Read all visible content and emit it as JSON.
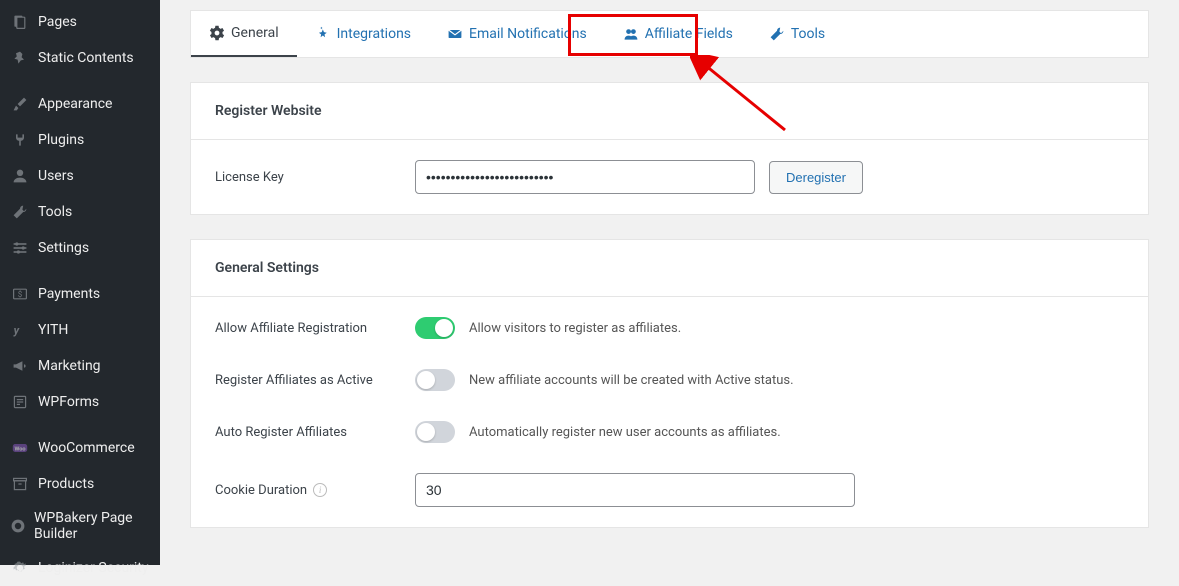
{
  "sidebar": {
    "items": [
      {
        "label": "Pages",
        "icon": "pages"
      },
      {
        "label": "Static Contents",
        "icon": "pin"
      },
      {
        "label": "Appearance",
        "icon": "brush"
      },
      {
        "label": "Plugins",
        "icon": "plug"
      },
      {
        "label": "Users",
        "icon": "user"
      },
      {
        "label": "Tools",
        "icon": "wrench"
      },
      {
        "label": "Settings",
        "icon": "sliders"
      },
      {
        "label": "Payments",
        "icon": "dollar"
      },
      {
        "label": "YITH",
        "icon": "yith"
      },
      {
        "label": "Marketing",
        "icon": "megaphone"
      },
      {
        "label": "WPForms",
        "icon": "form"
      },
      {
        "label": "WooCommerce",
        "icon": "woo"
      },
      {
        "label": "Products",
        "icon": "archive"
      },
      {
        "label": "WPBakery Page Builder",
        "icon": "wpb"
      },
      {
        "label": "Loginizer Security",
        "icon": "gear"
      }
    ]
  },
  "tabs": [
    {
      "label": "General",
      "icon": "gear"
    },
    {
      "label": "Integrations",
      "icon": "sparkle"
    },
    {
      "label": "Email Notifications",
      "icon": "mail"
    },
    {
      "label": "Affiliate Fields",
      "icon": "users"
    },
    {
      "label": "Tools",
      "icon": "wrench"
    }
  ],
  "register_website": {
    "title": "Register Website",
    "license_label": "License Key",
    "license_value": "••••••••••••••••••••••••••",
    "deregister_btn": "Deregister"
  },
  "general_settings": {
    "title": "General Settings",
    "allow_registration": {
      "label": "Allow Affiliate Registration",
      "help": "Allow visitors to register as affiliates.",
      "value": true
    },
    "register_active": {
      "label": "Register Affiliates as Active",
      "help": "New affiliate accounts will be created with Active status.",
      "value": false
    },
    "auto_register": {
      "label": "Auto Register Affiliates",
      "help": "Automatically register new user accounts as affiliates.",
      "value": false
    },
    "cookie_duration": {
      "label": "Cookie Duration",
      "value": "30"
    }
  }
}
